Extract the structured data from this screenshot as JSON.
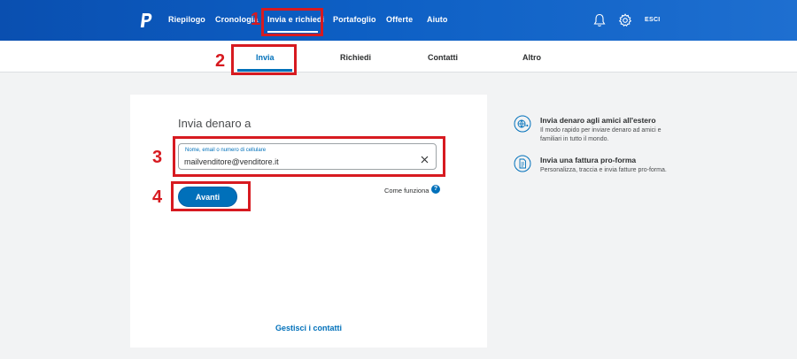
{
  "top_nav": {
    "items": [
      {
        "label": "Riepilogo"
      },
      {
        "label": "Cronologia"
      },
      {
        "label": "Invia e richiedi"
      },
      {
        "label": "Portafoglio"
      },
      {
        "label": "Offerte"
      },
      {
        "label": "Aiuto"
      }
    ],
    "active": "Invia e richiedi",
    "logout_label": "ESCI",
    "icons": [
      "paypal-logo-icon",
      "bell-icon",
      "gear-icon"
    ]
  },
  "sub_nav": {
    "tabs": [
      {
        "label": "Invia"
      },
      {
        "label": "Richiedi"
      },
      {
        "label": "Contatti"
      },
      {
        "label": "Altro"
      }
    ],
    "active": "Invia"
  },
  "send_form": {
    "title": "Invia denaro a",
    "field_label": "Nome, email o numero di cellulare",
    "field_value": "mailvenditore@venditore.it",
    "next_button": "Avanti",
    "how_it_works": "Come funziona",
    "help_glyph": "?",
    "manage_contacts": "Gestisci i contatti"
  },
  "promos": [
    {
      "icon": "globe-send-icon",
      "title": "Invia denaro agli amici all'estero",
      "description": "Il modo rapido per inviare denaro ad amici e familiari in tutto il mondo."
    },
    {
      "icon": "invoice-icon",
      "title": "Invia una fattura pro-forma",
      "description": "Personalizza, traccia e invia fatture pro-forma."
    }
  ],
  "annotations": [
    {
      "number": "1"
    },
    {
      "number": "2"
    },
    {
      "number": "3"
    },
    {
      "number": "4"
    }
  ],
  "colors": {
    "header_blue": "#0a4fb0",
    "accent_blue": "#0070ba",
    "annotation_red": "#d71a20",
    "page_bg": "#f2f3f4"
  }
}
